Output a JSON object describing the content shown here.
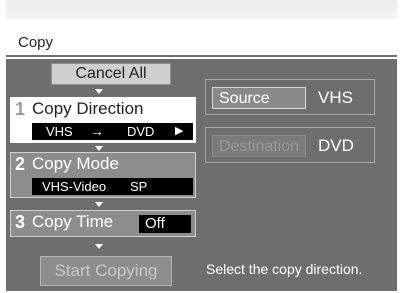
{
  "window": {
    "title": "Copy"
  },
  "buttons": {
    "cancel_all": "Cancel All",
    "start_copying": "Start Copying"
  },
  "steps": [
    {
      "number": "1",
      "label": "Copy Direction",
      "from": "VHS",
      "arrow": "→",
      "to": "DVD",
      "more": "▶"
    },
    {
      "number": "2",
      "label": "Copy Mode",
      "mode": "VHS-Video",
      "quality": "SP"
    },
    {
      "number": "3",
      "label": "Copy Time",
      "value": "Off"
    }
  ],
  "fields": {
    "source": {
      "label": "Source",
      "value": "VHS"
    },
    "destination": {
      "label": "Destination",
      "value": "DVD"
    }
  },
  "status": "Select the copy direction.",
  "colors": {
    "panel": "#6e6e6e",
    "selected_step": "#ffffff",
    "step": "#8d8d8d",
    "value_bar": "#000000"
  }
}
